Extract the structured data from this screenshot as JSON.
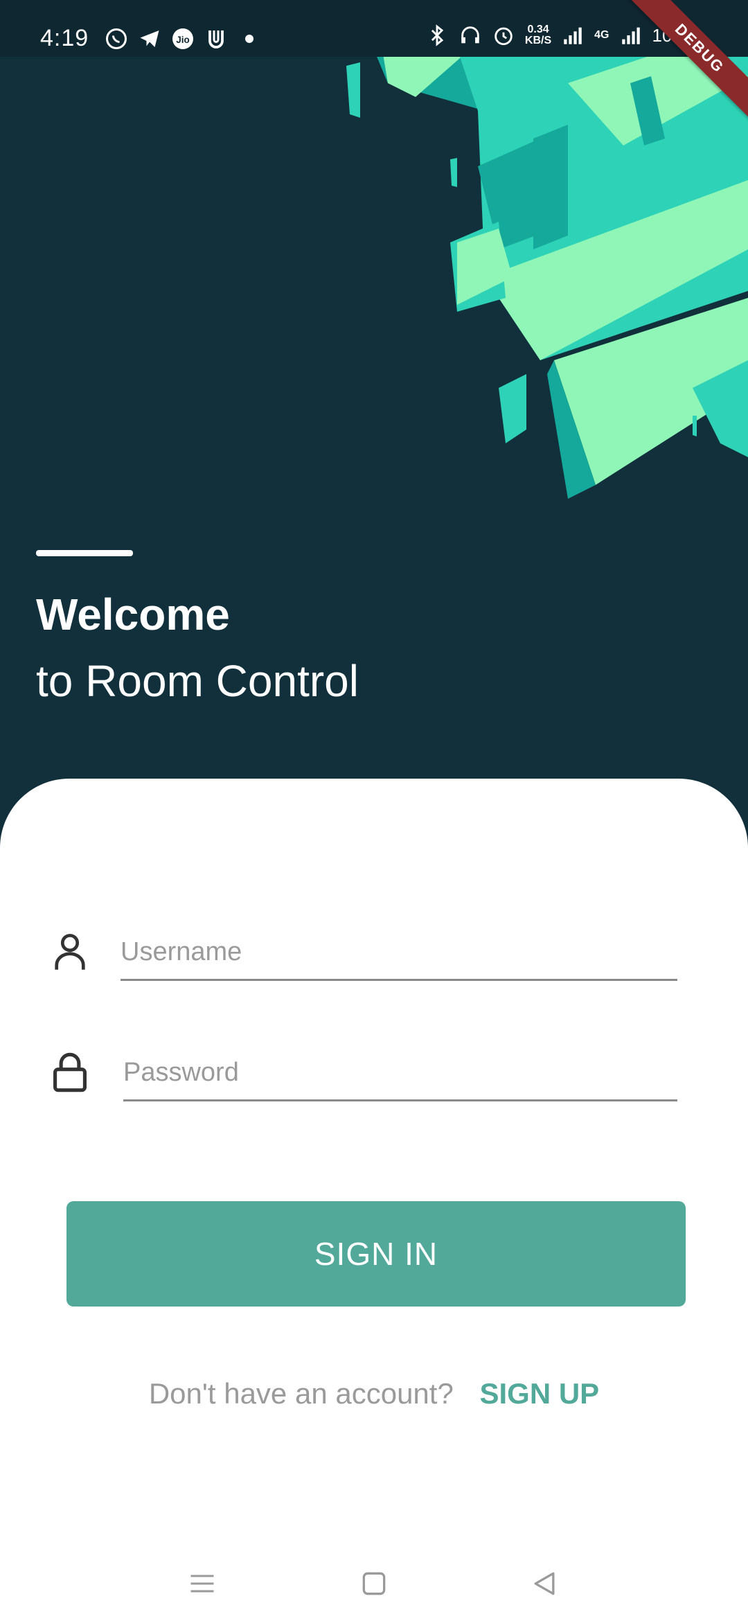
{
  "status_bar": {
    "time": "4:19",
    "speed_value": "0.34",
    "speed_unit": "KB/S",
    "network": "4G",
    "battery": "100%"
  },
  "debug_ribbon": "DEBUG",
  "hero": {
    "title": "Welcome",
    "subtitle": "to Room Control"
  },
  "form": {
    "username_placeholder": "Username",
    "password_placeholder": "Password",
    "signin_label": "SIGN IN",
    "signup_prompt": "Don't have an account?",
    "signup_label": "SIGN UP"
  },
  "colors": {
    "background": "#12303b",
    "accent": "#52a99a",
    "art_light": "#8ff6b7",
    "art_mid": "#2ed3b7",
    "art_dark": "#14a99a"
  },
  "icons": [
    "whatsapp-icon",
    "telegram-icon",
    "jio-icon",
    "u-app-icon",
    "bluetooth-icon",
    "headphones-icon",
    "alarm-icon",
    "signal-icon",
    "person-icon",
    "lock-icon",
    "menu-icon",
    "home-icon",
    "back-icon"
  ]
}
